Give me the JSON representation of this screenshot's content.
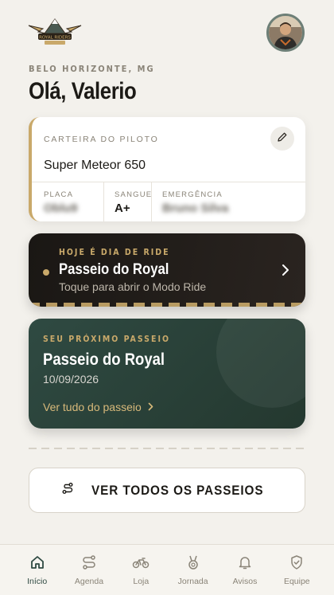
{
  "header": {
    "location": "BELO HORIZONTE, MG",
    "greeting": "Olá, Valerio",
    "logo_text": "ROYAL RIDERS"
  },
  "pilot_card": {
    "label": "CARTEIRA DO PILOTO",
    "bike": "Super Meteor 650",
    "fields": [
      {
        "key": "PLACA",
        "value": "Oblu9"
      },
      {
        "key": "SANGUE",
        "value": "A+"
      },
      {
        "key": "EMERGÊNCIA",
        "value": "Bruno Silva"
      }
    ]
  },
  "ride_today": {
    "kicker": "HOJE É DIA DE RIDE",
    "title": "Passeio do Royal",
    "subtitle": "Toque para abrir o Modo Ride"
  },
  "next_ride": {
    "kicker": "SEU PRÓXIMO PASSEIO",
    "title": "Passeio do Royal",
    "date": "10/09/2026",
    "link": "Ver tudo do passeio"
  },
  "all_rides_button": "VER TODOS OS PASSEIOS",
  "tabs": [
    {
      "label": "Início",
      "icon": "home-icon",
      "active": true
    },
    {
      "label": "Agenda",
      "icon": "route-icon",
      "active": false
    },
    {
      "label": "Loja",
      "icon": "bike-icon",
      "active": false
    },
    {
      "label": "Jornada",
      "icon": "medal-icon",
      "active": false
    },
    {
      "label": "Avisos",
      "icon": "bell-icon",
      "active": false
    },
    {
      "label": "Equipe",
      "icon": "shield-check-icon",
      "active": false
    }
  ],
  "colors": {
    "background": "#f3f1ec",
    "gold": "#c9a96a",
    "ride_card": "#1a1714",
    "next_card": "#2f4a42",
    "active_tab": "#2f4a42"
  }
}
